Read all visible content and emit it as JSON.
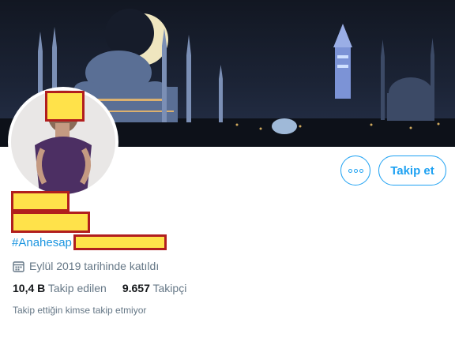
{
  "profile": {
    "hashtag": "#Anahesap",
    "joined": "Eylül 2019 tarihinde katıldı",
    "following_count": "10,4 B",
    "following_label": "Takip edilen",
    "followers_count": "9.657",
    "followers_label": "Takipçi",
    "followed_by_note": "Takip ettiğin kimse takip etmiyor"
  },
  "actions": {
    "follow_label": "Takip et",
    "more_icon": "more-options-icon"
  },
  "icons": {
    "joined": "calendar-icon"
  },
  "colors": {
    "accent": "#1da1f2",
    "secondary_text": "#657786",
    "redaction_fill": "#ffe24a",
    "redaction_border": "#b11e1e"
  }
}
